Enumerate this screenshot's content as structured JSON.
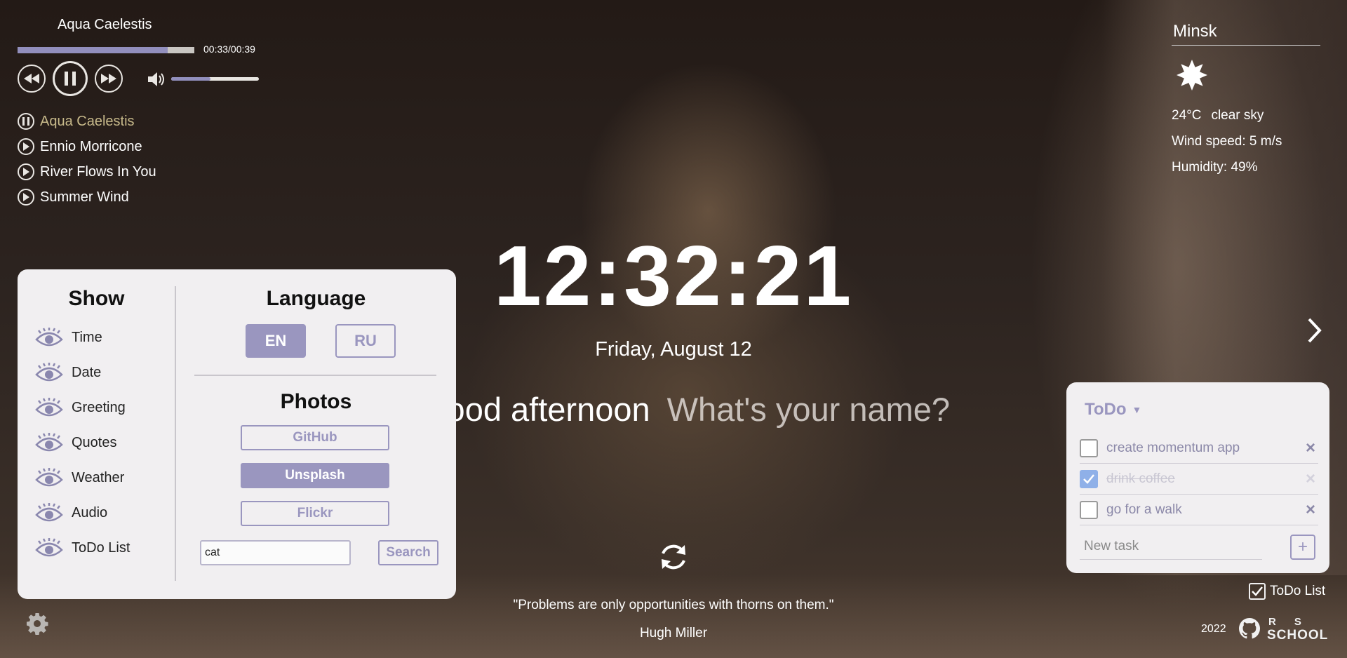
{
  "player": {
    "current_title": "Aqua Caelestis",
    "time": "00:33/00:39",
    "progress": 0.85,
    "volume": 0.45,
    "playlist": [
      {
        "title": "Aqua Caelestis",
        "active": true
      },
      {
        "title": "Ennio Morricone",
        "active": false
      },
      {
        "title": "River Flows In You",
        "active": false
      },
      {
        "title": "Summer Wind",
        "active": false
      }
    ]
  },
  "weather": {
    "city": "Minsk",
    "icon": "sun-icon",
    "temperature": "24°C",
    "description": "clear sky",
    "wind": "Wind speed: 5 m/s",
    "humidity": "Humidity: 49%"
  },
  "clock": {
    "time": "12:32:21",
    "date": "Friday, August 12"
  },
  "greeting": {
    "text": "Good afternoon",
    "name_placeholder": "What's your name?"
  },
  "quote": {
    "text": "\"Problems are only opportunities with thorns on them.\"",
    "author": "Hugh Miller"
  },
  "settings": {
    "show_heading": "Show",
    "show_items": [
      {
        "label": "Time"
      },
      {
        "label": "Date"
      },
      {
        "label": "Greeting"
      },
      {
        "label": "Quotes"
      },
      {
        "label": "Weather"
      },
      {
        "label": "Audio"
      },
      {
        "label": "ToDo List"
      }
    ],
    "language_heading": "Language",
    "lang_en": "EN",
    "lang_ru": "RU",
    "photos_heading": "Photos",
    "source_github": "GitHub",
    "source_unsplash": "Unsplash",
    "source_flickr": "Flickr",
    "tag_value": "cat",
    "search_label": "Search"
  },
  "todo": {
    "title": "ToDo",
    "caret": "▼",
    "tasks": [
      {
        "text": "create momentum app",
        "done": false
      },
      {
        "text": "drink coffee",
        "done": true
      },
      {
        "text": "go for a walk",
        "done": false
      }
    ],
    "new_task_placeholder": "New task",
    "add_label": "+",
    "delete_label": "×",
    "toggle_label": "ToDo List"
  },
  "footer": {
    "year": "2022",
    "logo_top": "RS",
    "logo_bottom": "SCHOOL"
  },
  "colors": {
    "accent": "#9a96bf",
    "active_track": "#c7b98a",
    "panel_bg": "#f1eff1"
  }
}
